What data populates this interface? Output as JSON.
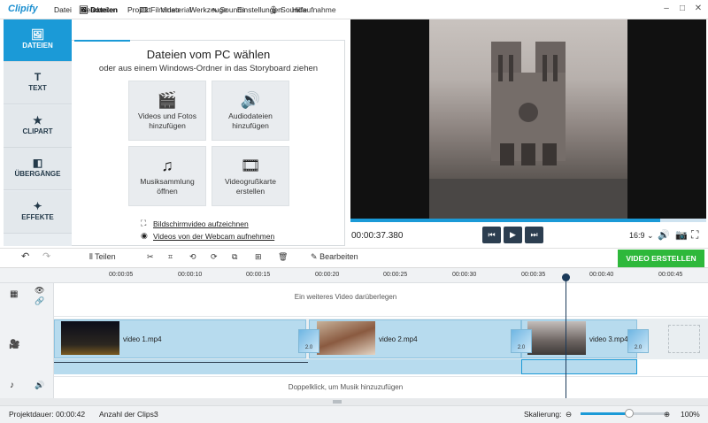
{
  "app": {
    "name": "Clipify"
  },
  "menu": [
    "Datei",
    "Bearbeiten",
    "Projekt",
    "Video",
    "Werkzeuge",
    "Einstellungen",
    "Hilfe"
  ],
  "window_controls": {
    "minimize": "–",
    "maximize": "□",
    "close": "✕"
  },
  "sidebar": {
    "items": [
      {
        "label": "DATEIEN",
        "icon": "image-icon",
        "glyph": "🖼"
      },
      {
        "label": "TEXT",
        "icon": "text-icon",
        "glyph": "T"
      },
      {
        "label": "CLIPART",
        "icon": "star-icon",
        "glyph": "★"
      },
      {
        "label": "ÜBERGÄNGE",
        "icon": "transition-icon",
        "glyph": "◧"
      },
      {
        "label": "EFFEKTE",
        "icon": "magic-wand-icon",
        "glyph": "✦"
      }
    ]
  },
  "tabs": [
    {
      "label": "Dateien",
      "glyph": "🖼"
    },
    {
      "label": "Filmmaterial",
      "glyph": "🎞"
    },
    {
      "label": "Sounds",
      "glyph": "∿"
    },
    {
      "label": "Soundaufnahme",
      "glyph": "🎙"
    }
  ],
  "panel": {
    "title": "Dateien vom PC wählen",
    "subtitle": "oder aus einem Windows-Ordner in das Storyboard ziehen",
    "tiles": [
      {
        "label": "Videos und Fotos hinzufügen",
        "glyph": "🎬"
      },
      {
        "label": "Audiodateien hinzufügen",
        "glyph": "🔊"
      },
      {
        "label": "Musiksammlung öffnen",
        "glyph": "♫"
      },
      {
        "label": "Videogrußkarte erstellen",
        "glyph": "🎞"
      }
    ],
    "links": [
      {
        "label": "Bildschirmvideo aufzeichnen",
        "glyph": "⛶"
      },
      {
        "label": "Videos von der Webcam aufnehmen",
        "glyph": "◉"
      }
    ]
  },
  "player": {
    "time": "00:00:37.380",
    "progress": 0.87,
    "aspect": "16:9 ⌄",
    "buttons": {
      "prev": "⏮",
      "play": "▶",
      "next": "⏭"
    }
  },
  "toolbar": {
    "undo": "↶",
    "redo": "↷",
    "split": "Teilen",
    "edit": "Bearbeiten",
    "export": "VIDEO ERSTELLEN"
  },
  "timeline": {
    "ticks": [
      "00:00:05",
      "00:00:10",
      "00:00:15",
      "00:00:20",
      "00:00:25",
      "00:00:30",
      "00:00:35",
      "00:00:40",
      "00:00:45"
    ],
    "overlay_hint": "Ein weiteres Video darüberlegen",
    "music_hint": "Doppelklick, um Musik hinzuzufügen",
    "clips": [
      {
        "label": "video 1.mp4"
      },
      {
        "label": "video 2.mp4"
      },
      {
        "label": "video 3.mp4"
      }
    ],
    "transitions": [
      "2.0",
      "2.0",
      "2.0"
    ]
  },
  "status": {
    "duration_label": "Projektdauer:",
    "duration": "00:00:42",
    "clips_label": "Anzahl der Clips:",
    "clips": "3",
    "scale_label": "Skalierung:",
    "scale_value": "100%",
    "zoom": 0.55
  },
  "colors": {
    "accent": "#1b9ad7",
    "export": "#2eb83b",
    "clip": "#b7dbee"
  }
}
